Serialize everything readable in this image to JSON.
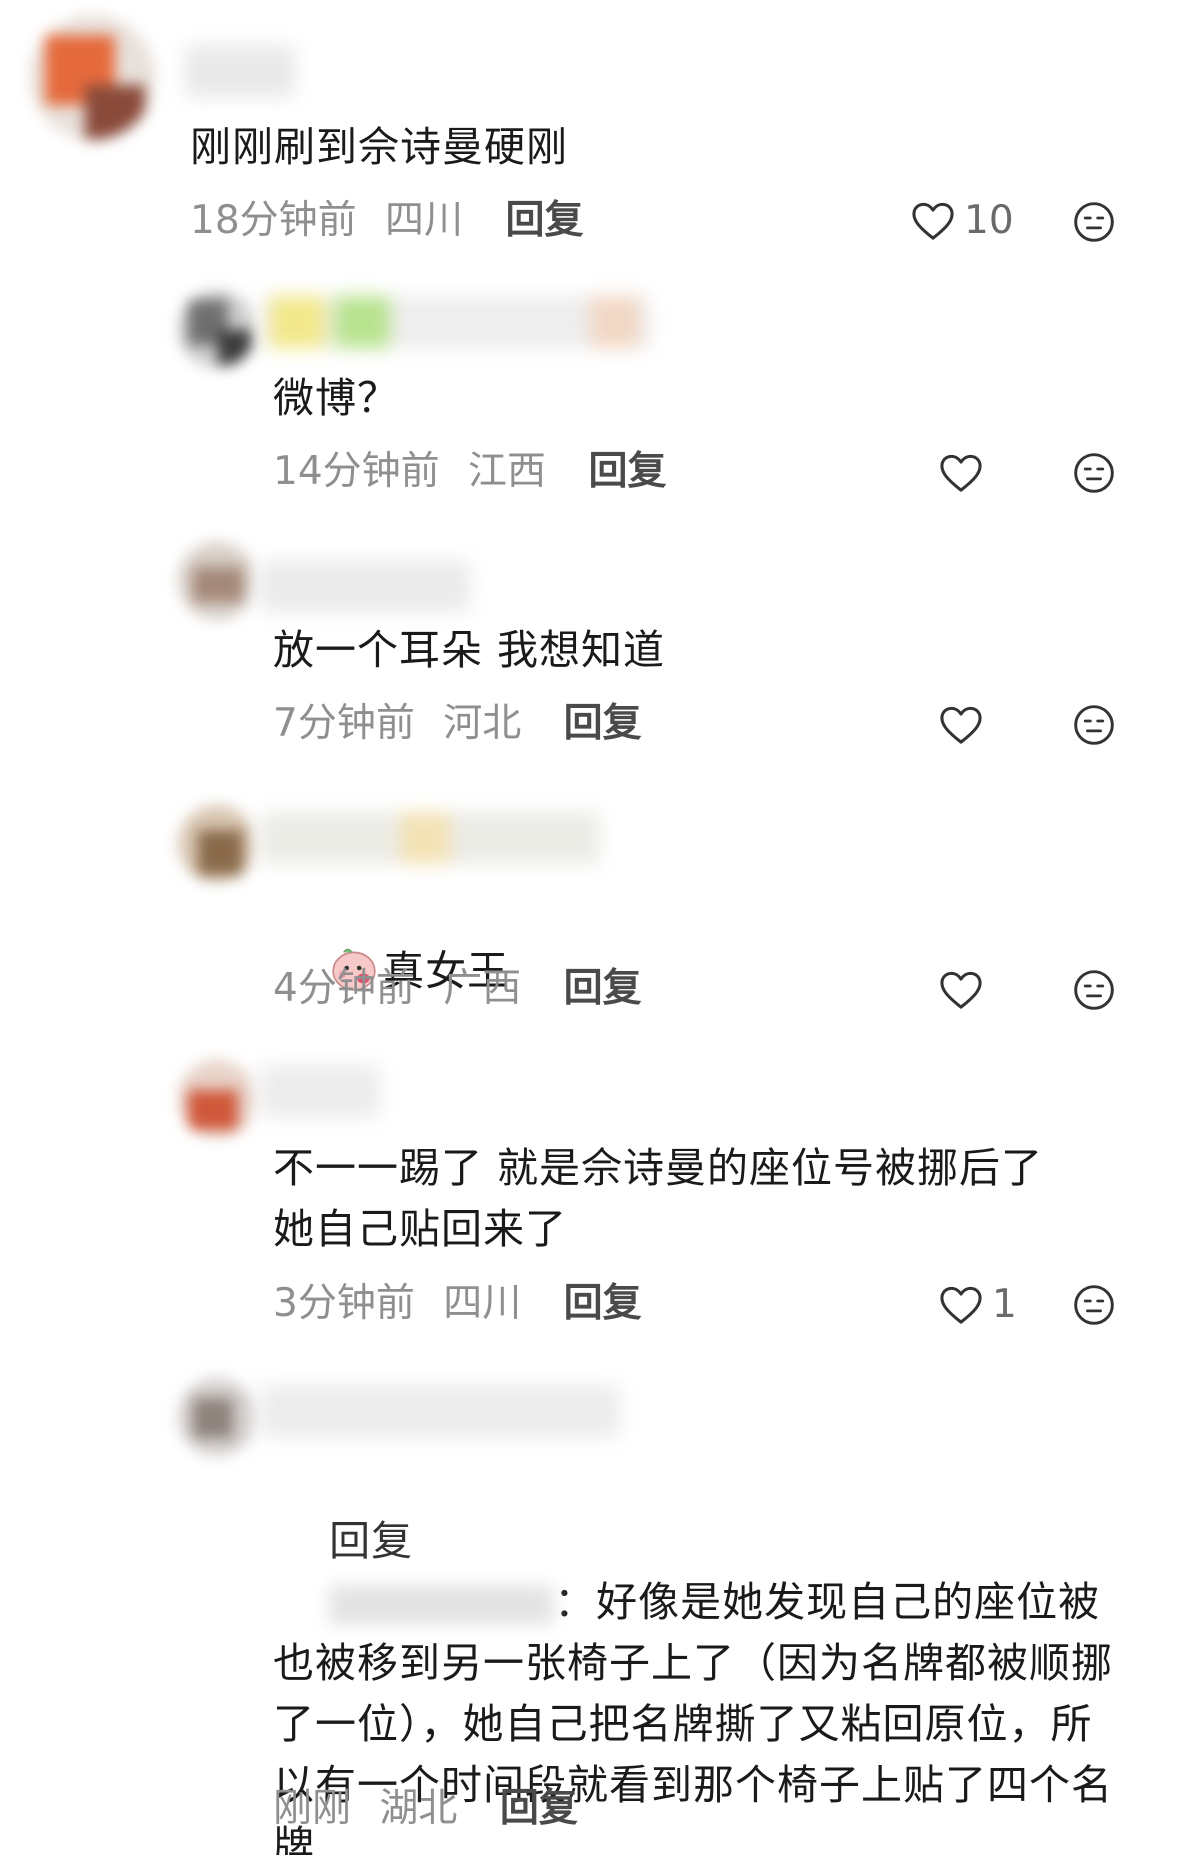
{
  "comments": [
    {
      "text": "刚刚刷到佘诗曼硬刚",
      "time": "18分钟前",
      "location": "四川",
      "reply_label": "回复",
      "likes": "10"
    },
    {
      "text": "微博？",
      "time": "14分钟前",
      "location": "江西",
      "reply_label": "回复",
      "likes": ""
    },
    {
      "text": "放一个耳朵 我想知道",
      "time": "7分钟前",
      "location": "河北",
      "reply_label": "回复",
      "likes": ""
    },
    {
      "text": "真女王",
      "time": "4分钟前",
      "location": "广西",
      "reply_label": "回复",
      "likes": ""
    },
    {
      "text": "不一一踢了 就是佘诗曼的座位号被挪后了\n她自己贴回来了",
      "time": "3分钟前",
      "location": "四川",
      "reply_label": "回复",
      "likes": "1"
    },
    {
      "reply_prefix": "回复",
      "text": "好像是她发现自己的座位被也被移到另一张椅子上了（因为名牌都被顺挪了一位），她自己把名牌撕了又粘回原位，所以有一个时间段就看到那个椅子上贴了四个名牌",
      "time": "刚刚",
      "location": "湖北",
      "reply_label": "回复"
    }
  ],
  "icons": {
    "like": "heart-outline-icon",
    "dislike": "meh-face-icon",
    "emoji": "pink-face-emoji-icon"
  },
  "colors": {
    "text": "#1a1a1a",
    "meta": "#8f8f8f",
    "reply": "#4a4a4a",
    "icon": "#333333"
  }
}
